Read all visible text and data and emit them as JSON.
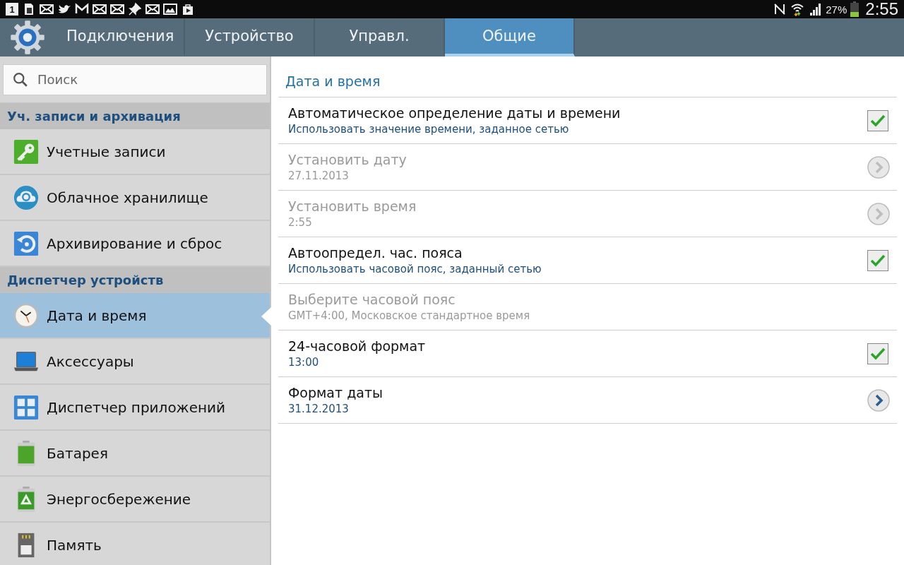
{
  "status_bar": {
    "notification_count": "1",
    "battery": "27%",
    "time": "2:55"
  },
  "tabs": [
    {
      "label": "Подключения",
      "selected": false
    },
    {
      "label": "Устройство",
      "selected": false
    },
    {
      "label": "Управл.",
      "selected": false
    },
    {
      "label": "Общие",
      "selected": true
    }
  ],
  "search": {
    "placeholder": "Поиск"
  },
  "sidebar": {
    "items": [
      {
        "kind": "header",
        "label": "Уч. записи и архивация"
      },
      {
        "kind": "item",
        "label": "Учетные записи",
        "selected": false
      },
      {
        "kind": "item",
        "label": "Облачное хранилище",
        "selected": false
      },
      {
        "kind": "item",
        "label": "Архивирование и сброс",
        "selected": false
      },
      {
        "kind": "header",
        "label": "Диспетчер устройств"
      },
      {
        "kind": "item",
        "label": "Дата и время",
        "selected": true
      },
      {
        "kind": "item",
        "label": "Аксессуары",
        "selected": false
      },
      {
        "kind": "item",
        "label": "Диспетчер приложений",
        "selected": false
      },
      {
        "kind": "item",
        "label": "Батарея",
        "selected": false
      },
      {
        "kind": "item",
        "label": "Энергосбережение",
        "selected": false
      },
      {
        "kind": "item",
        "label": "Память",
        "selected": false
      }
    ]
  },
  "detail": {
    "title": "Дата и время",
    "rows": [
      {
        "kind": "checkbox",
        "title": "Автоматическое определение даты и времени",
        "summary": "Использовать значение времени, заданное сетью",
        "disabled": false,
        "checked": true
      },
      {
        "kind": "arrow",
        "title": "Установить дату",
        "summary": "27.11.2013",
        "disabled": true
      },
      {
        "kind": "arrow",
        "title": "Установить время",
        "summary": "2:55",
        "disabled": true
      },
      {
        "kind": "checkbox",
        "title": "Автоопредел. час. пояса",
        "summary": "Использовать часовой пояс, заданный сетью",
        "disabled": false,
        "checked": true
      },
      {
        "kind": "plain",
        "title": "Выберите часовой пояс",
        "summary": "GMT+4:00, Московское стандартное время",
        "disabled": true
      },
      {
        "kind": "checkbox",
        "title": "24-часовой формат",
        "summary": "13:00",
        "disabled": false,
        "checked": true
      },
      {
        "kind": "arrow",
        "title": "Формат даты",
        "summary": "31.12.2013",
        "disabled": false
      }
    ]
  }
}
